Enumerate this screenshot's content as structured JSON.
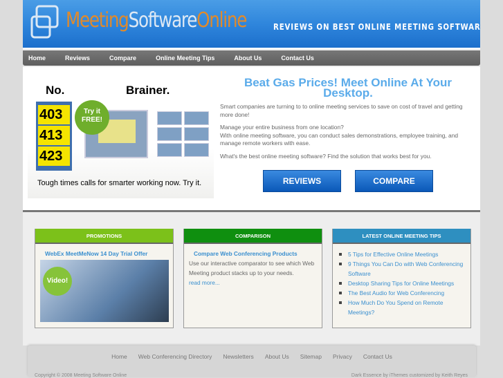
{
  "header": {
    "logo_part1": "Meeting",
    "logo_part2": "Software",
    "logo_part3": "Online",
    "tagline": "REVIEWS ON BEST ONLINE MEETING SOFTWARE"
  },
  "nav": [
    "Home",
    "Reviews",
    "Compare",
    "Online Meeting Tips",
    "About Us",
    "Contact Us"
  ],
  "banner": {
    "no": "No.",
    "brainer": "Brainer.",
    "prices": [
      "403",
      "413",
      "423"
    ],
    "badge": "Try it FREE!",
    "caption": "Tough times calls for smarter working now. Try it."
  },
  "hero": {
    "title": "Beat Gas Prices! Meet Online At Your Desktop.",
    "p1": "Smart companies are turning to to online meeting services to save on cost of travel and getting more done!",
    "p2a": "Manage your entire business from one location?",
    "p2b": "With online meeting software, you can conduct sales demonstrations, employee training, and manage remote workers with ease.",
    "p3": "What's the best online meeting software? Find the solution that works best for you.",
    "reviews_button": "REVIEWS",
    "compare_button": "COMPARE"
  },
  "promotions": {
    "heading": "PROMOTIONS",
    "title": "WebEx MeetMeNow 14 Day Trial Offer",
    "badge": "Video!",
    "color": "#7cc11a"
  },
  "comparison": {
    "heading": "COMPARISON",
    "title": "Compare Web Conferencing Products",
    "text": "Use our interactive comparator to see which Web Meeting product stacks up to your needs.",
    "read_more": "read more...",
    "color": "#0f8f0f"
  },
  "tips": {
    "heading": "LATEST ONLINE MEETING TIPS",
    "color": "#2e8fc0",
    "items": [
      "5 Tips for Effective Online Meetings",
      "9 Things You Can Do with Web Conferencing Software",
      "Desktop Sharing Tips for Online Meetings",
      "The Best Audio for Web Conferencing",
      "How Much Do You Spend on Remote Meetings?"
    ]
  },
  "footer": {
    "links": [
      "Home",
      "Web Conferencing Directory",
      "Newsletters",
      "About Us",
      "Sitemap",
      "Privacy",
      "Contact Us"
    ],
    "copyright": "Copyright © 2008 Meeting Software Online",
    "credit": "Dark Essence by iThemes customized by Keith Reyes"
  }
}
